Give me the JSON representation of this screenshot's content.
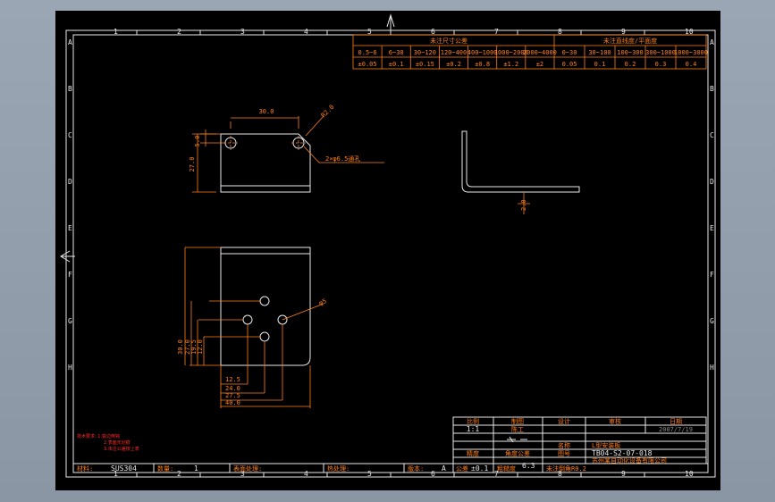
{
  "border": {
    "top_numbers": [
      "1",
      "2",
      "3",
      "4",
      "5",
      "6",
      "7",
      "8",
      "9",
      "10"
    ],
    "bottom_numbers": [
      "1",
      "2",
      "3",
      "4",
      "5",
      "6",
      "7",
      "8",
      "9",
      "10"
    ],
    "side_letters": [
      "A",
      "B",
      "C",
      "D",
      "E",
      "F",
      "G",
      "H"
    ]
  },
  "tolerance_table": {
    "header_left": "未注尺寸公差",
    "header_right": "未注直线度/平面度",
    "ranges_left": [
      "0.5~6",
      "6~30",
      "30~120",
      "120~400",
      "400~1000",
      "1000~2000",
      "2000~4000"
    ],
    "values_left": [
      "±0.05",
      "±0.1",
      "±0.15",
      "±0.2",
      "±0.8",
      "±1.2",
      "±2"
    ],
    "ranges_right": [
      "0~30",
      "30~100",
      "100~300",
      "300~1000",
      "1000~3000"
    ],
    "values_right": [
      "0.05",
      "0.1",
      "0.2",
      "0.3",
      "0.4"
    ]
  },
  "dims": {
    "d30": "30.0",
    "d5": "5.0",
    "d27": "27.0",
    "r2": "R2.0",
    "holes": "2×φ6.5通孔",
    "d20": "2.0",
    "phi5": "φ5",
    "d12": "12.5",
    "d24": "24.0",
    "d27b": "27.5",
    "d40": "40.0",
    "v30": "30.0",
    "v27": "27.0",
    "v19": "19.5",
    "v12": "12.0"
  },
  "notes": [
    "技术要求: 1.锐边倒钝",
    "2.表面无划痕",
    "3.未注公差按上表"
  ],
  "title_block": {
    "h_scale": "比例",
    "h_draw": "制图",
    "h_design": "设计",
    "h_review": "审核",
    "h_date": "日期",
    "scale": "1:1",
    "drawer": "陈工",
    "date": "2007/7/19",
    "proj_label": "名称",
    "name": "L型安装板",
    "prec_label": "精度",
    "prec_note": "角度公差",
    "fig_label": "图号",
    "drawing_no": "TB04-S2-07-018",
    "company": "苏州某自动化设备有限公司"
  },
  "bottom_strip": {
    "material_label": "材料:",
    "material": "SUS304",
    "qty_label": "数量:",
    "qty": "1",
    "surface_label": "表面处理:",
    "heat_label": "热处理:",
    "rev_label": "版本:",
    "rev": "A",
    "tol_label": "公差",
    "tol": "±0.1",
    "rough_label": "粗糙度",
    "rough": "6.3",
    "std_label": "未注倒角R0.2"
  }
}
